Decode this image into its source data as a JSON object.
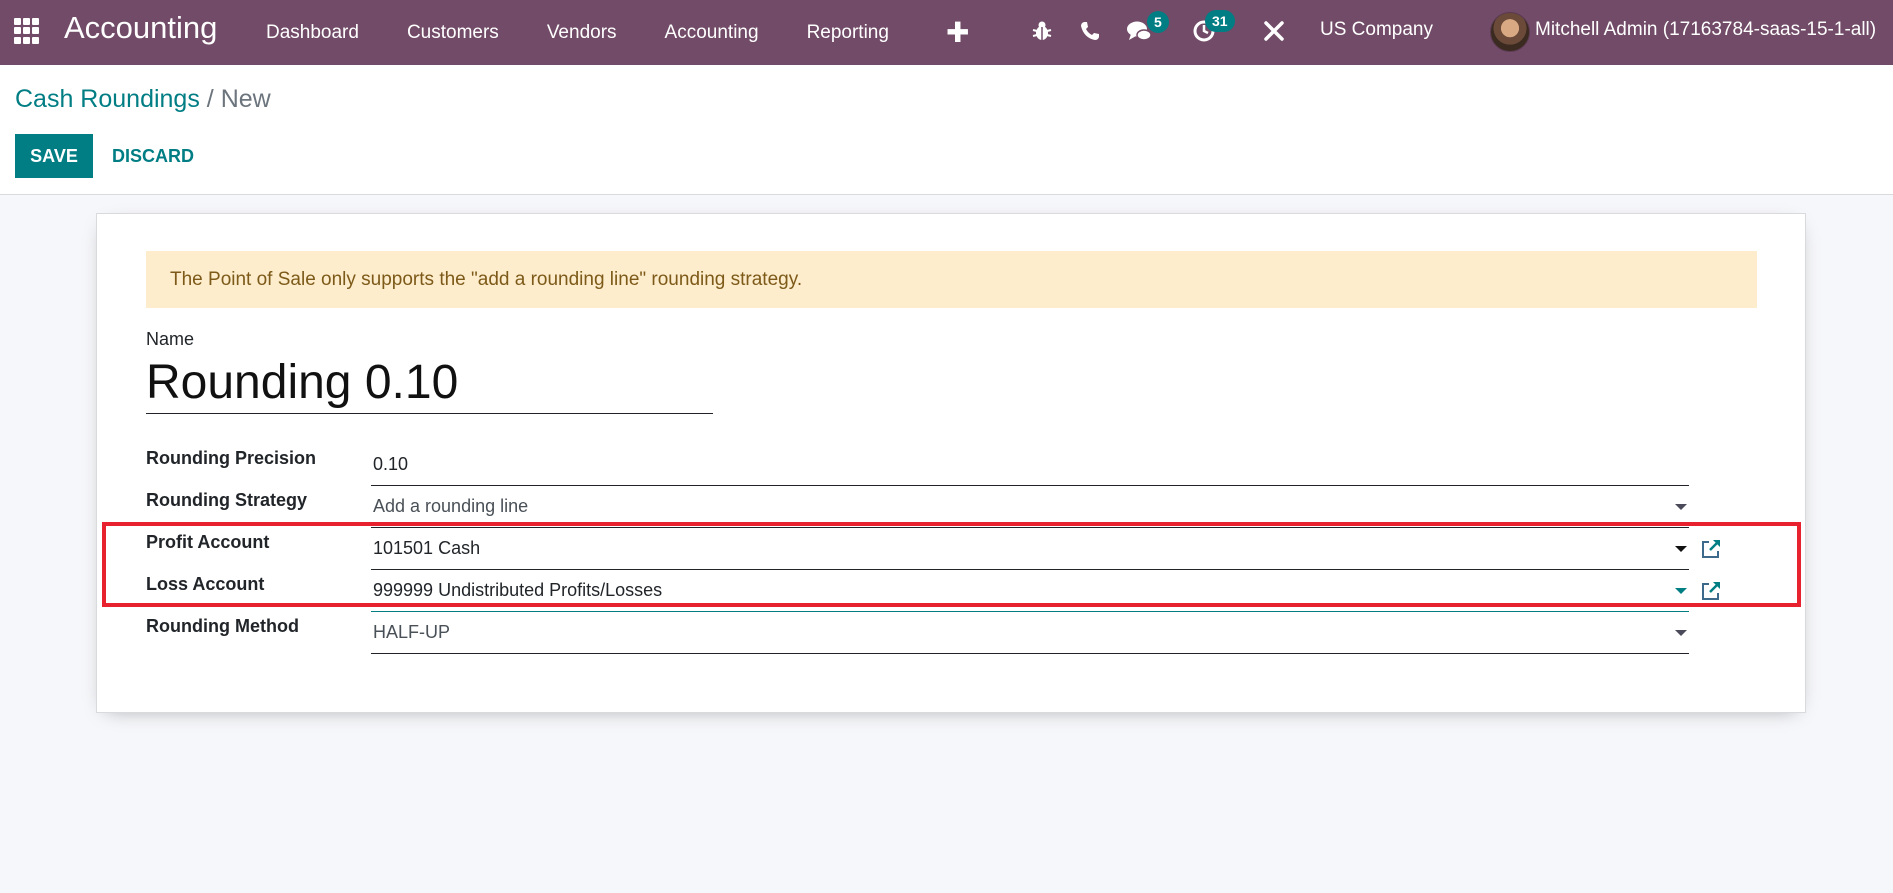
{
  "navbar": {
    "app_name": "Accounting",
    "menu": [
      "Dashboard",
      "Customers",
      "Vendors",
      "Accounting",
      "Reporting"
    ],
    "icons": {
      "apps": "apps-grid-icon",
      "plus": "plus-icon",
      "debug": "bug-icon",
      "phone": "phone-icon",
      "chat": "chat-icon",
      "activity": "clock-icon",
      "settings": "tools-icon"
    },
    "plus_glyph": "✚",
    "chat_badge": "5",
    "activity_badge": "31",
    "company": "US Company",
    "user": "Mitchell Admin (17163784-saas-15-1-all)"
  },
  "breadcrumb": {
    "parent": "Cash Roundings",
    "separator": " / ",
    "current": "New"
  },
  "toolbar": {
    "save_label": "SAVE",
    "discard_label": "DISCARD"
  },
  "form": {
    "alert": "The Point of Sale only supports the \"add a rounding line\" rounding strategy.",
    "name_label": "Name",
    "name_value": "Rounding 0.10",
    "fields": [
      {
        "label": "Rounding Precision",
        "value": "0.10"
      },
      {
        "label": "Rounding Strategy",
        "value": "Add a rounding line"
      },
      {
        "label": "Profit Account",
        "value": "101501 Cash"
      },
      {
        "label": "Loss Account",
        "value": "999999 Undistributed Profits/Losses"
      },
      {
        "label": "Rounding Method",
        "value": "HALF-UP"
      }
    ]
  },
  "colors": {
    "navbar": "#714b67",
    "primary": "#017e84",
    "alert_bg": "#fdedcc",
    "highlight": "#e8212e"
  }
}
